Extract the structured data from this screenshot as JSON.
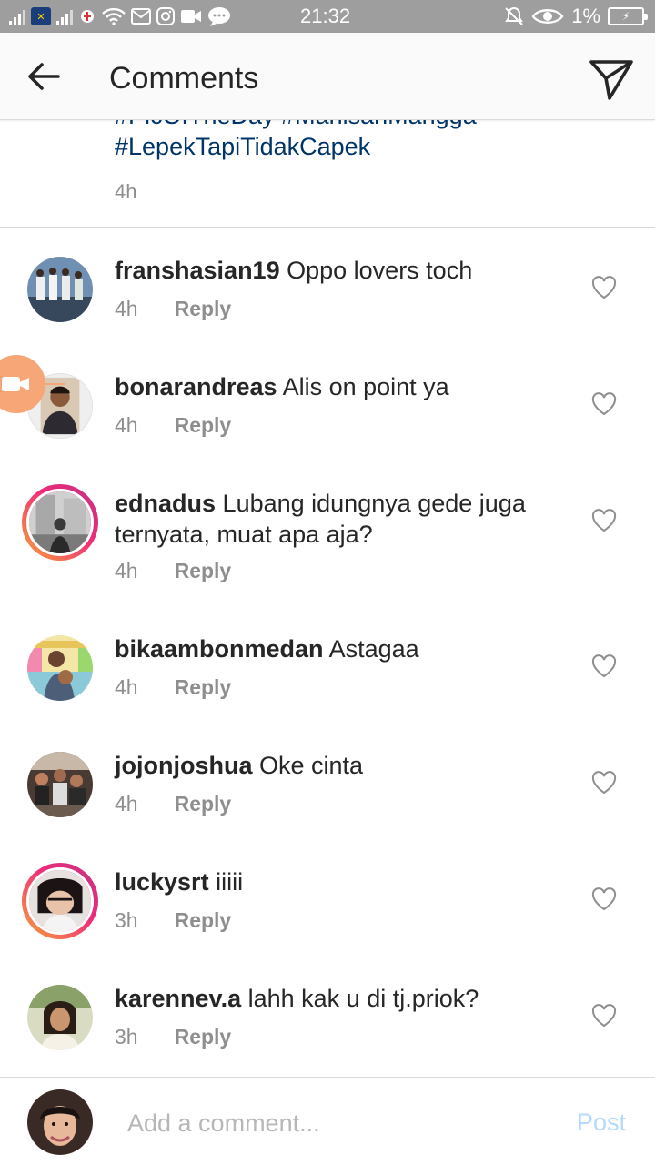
{
  "status_bar": {
    "time": "21:32",
    "battery": "1%",
    "icons": [
      "signal-icon",
      "app-icon",
      "signal-icon",
      "app-notification-icon",
      "wifi-icon",
      "mail-icon",
      "instagram-icon",
      "video-icon",
      "chat-icon",
      "mute-icon",
      "eye-icon",
      "battery-icon"
    ]
  },
  "header": {
    "title": "Comments",
    "back_icon": "arrow-left-icon",
    "send_icon": "paper-plane-icon"
  },
  "caption": {
    "tags": [
      "#PicOfTheDay #ManisanMangga",
      "#LepekTapiTidakCapek"
    ],
    "time": "4h"
  },
  "comments": [
    {
      "user": "franshasian19",
      "text": "Oppo lovers toch",
      "time": "4h",
      "reply": "Reply",
      "ring": false
    },
    {
      "user": "bonarandreas",
      "text": "Alis on point ya",
      "time": "4h",
      "reply": "Reply",
      "ring": false
    },
    {
      "user": "ednadus",
      "text": "Lubang idungnya gede juga ternyata, muat apa aja?",
      "time": "4h",
      "reply": "Reply",
      "ring": true
    },
    {
      "user": "bikaambonmedan",
      "text": "Astagaa",
      "time": "4h",
      "reply": "Reply",
      "ring": false
    },
    {
      "user": "jojonjoshua",
      "text": "Oke cinta",
      "time": "4h",
      "reply": "Reply",
      "ring": false
    },
    {
      "user": "luckysrt",
      "text": "iiiii",
      "time": "3h",
      "reply": "Reply",
      "ring": true
    },
    {
      "user": "karennev.a",
      "text": "lahh kak u di tj.priok?",
      "time": "3h",
      "reply": "Reply",
      "ring": false
    }
  ],
  "footer": {
    "placeholder": "Add a comment...",
    "post_label": "Post"
  },
  "colors": {
    "hashtag": "#003569",
    "meta": "#8e8e8e",
    "post": "#b3dbff",
    "status_bar": "#9e9e9e"
  }
}
